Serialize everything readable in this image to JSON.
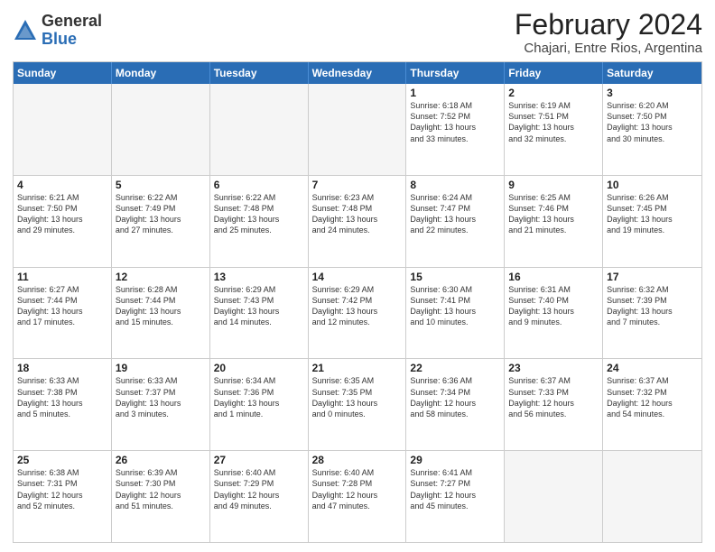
{
  "header": {
    "logo_general": "General",
    "logo_blue": "Blue",
    "title": "February 2024",
    "subtitle": "Chajari, Entre Rios, Argentina"
  },
  "calendar": {
    "days_of_week": [
      "Sunday",
      "Monday",
      "Tuesday",
      "Wednesday",
      "Thursday",
      "Friday",
      "Saturday"
    ],
    "rows": [
      [
        {
          "day": "",
          "info": ""
        },
        {
          "day": "",
          "info": ""
        },
        {
          "day": "",
          "info": ""
        },
        {
          "day": "",
          "info": ""
        },
        {
          "day": "1",
          "info": "Sunrise: 6:18 AM\nSunset: 7:52 PM\nDaylight: 13 hours\nand 33 minutes."
        },
        {
          "day": "2",
          "info": "Sunrise: 6:19 AM\nSunset: 7:51 PM\nDaylight: 13 hours\nand 32 minutes."
        },
        {
          "day": "3",
          "info": "Sunrise: 6:20 AM\nSunset: 7:50 PM\nDaylight: 13 hours\nand 30 minutes."
        }
      ],
      [
        {
          "day": "4",
          "info": "Sunrise: 6:21 AM\nSunset: 7:50 PM\nDaylight: 13 hours\nand 29 minutes."
        },
        {
          "day": "5",
          "info": "Sunrise: 6:22 AM\nSunset: 7:49 PM\nDaylight: 13 hours\nand 27 minutes."
        },
        {
          "day": "6",
          "info": "Sunrise: 6:22 AM\nSunset: 7:48 PM\nDaylight: 13 hours\nand 25 minutes."
        },
        {
          "day": "7",
          "info": "Sunrise: 6:23 AM\nSunset: 7:48 PM\nDaylight: 13 hours\nand 24 minutes."
        },
        {
          "day": "8",
          "info": "Sunrise: 6:24 AM\nSunset: 7:47 PM\nDaylight: 13 hours\nand 22 minutes."
        },
        {
          "day": "9",
          "info": "Sunrise: 6:25 AM\nSunset: 7:46 PM\nDaylight: 13 hours\nand 21 minutes."
        },
        {
          "day": "10",
          "info": "Sunrise: 6:26 AM\nSunset: 7:45 PM\nDaylight: 13 hours\nand 19 minutes."
        }
      ],
      [
        {
          "day": "11",
          "info": "Sunrise: 6:27 AM\nSunset: 7:44 PM\nDaylight: 13 hours\nand 17 minutes."
        },
        {
          "day": "12",
          "info": "Sunrise: 6:28 AM\nSunset: 7:44 PM\nDaylight: 13 hours\nand 15 minutes."
        },
        {
          "day": "13",
          "info": "Sunrise: 6:29 AM\nSunset: 7:43 PM\nDaylight: 13 hours\nand 14 minutes."
        },
        {
          "day": "14",
          "info": "Sunrise: 6:29 AM\nSunset: 7:42 PM\nDaylight: 13 hours\nand 12 minutes."
        },
        {
          "day": "15",
          "info": "Sunrise: 6:30 AM\nSunset: 7:41 PM\nDaylight: 13 hours\nand 10 minutes."
        },
        {
          "day": "16",
          "info": "Sunrise: 6:31 AM\nSunset: 7:40 PM\nDaylight: 13 hours\nand 9 minutes."
        },
        {
          "day": "17",
          "info": "Sunrise: 6:32 AM\nSunset: 7:39 PM\nDaylight: 13 hours\nand 7 minutes."
        }
      ],
      [
        {
          "day": "18",
          "info": "Sunrise: 6:33 AM\nSunset: 7:38 PM\nDaylight: 13 hours\nand 5 minutes."
        },
        {
          "day": "19",
          "info": "Sunrise: 6:33 AM\nSunset: 7:37 PM\nDaylight: 13 hours\nand 3 minutes."
        },
        {
          "day": "20",
          "info": "Sunrise: 6:34 AM\nSunset: 7:36 PM\nDaylight: 13 hours\nand 1 minute."
        },
        {
          "day": "21",
          "info": "Sunrise: 6:35 AM\nSunset: 7:35 PM\nDaylight: 13 hours\nand 0 minutes."
        },
        {
          "day": "22",
          "info": "Sunrise: 6:36 AM\nSunset: 7:34 PM\nDaylight: 12 hours\nand 58 minutes."
        },
        {
          "day": "23",
          "info": "Sunrise: 6:37 AM\nSunset: 7:33 PM\nDaylight: 12 hours\nand 56 minutes."
        },
        {
          "day": "24",
          "info": "Sunrise: 6:37 AM\nSunset: 7:32 PM\nDaylight: 12 hours\nand 54 minutes."
        }
      ],
      [
        {
          "day": "25",
          "info": "Sunrise: 6:38 AM\nSunset: 7:31 PM\nDaylight: 12 hours\nand 52 minutes."
        },
        {
          "day": "26",
          "info": "Sunrise: 6:39 AM\nSunset: 7:30 PM\nDaylight: 12 hours\nand 51 minutes."
        },
        {
          "day": "27",
          "info": "Sunrise: 6:40 AM\nSunset: 7:29 PM\nDaylight: 12 hours\nand 49 minutes."
        },
        {
          "day": "28",
          "info": "Sunrise: 6:40 AM\nSunset: 7:28 PM\nDaylight: 12 hours\nand 47 minutes."
        },
        {
          "day": "29",
          "info": "Sunrise: 6:41 AM\nSunset: 7:27 PM\nDaylight: 12 hours\nand 45 minutes."
        },
        {
          "day": "",
          "info": ""
        },
        {
          "day": "",
          "info": ""
        }
      ]
    ]
  }
}
